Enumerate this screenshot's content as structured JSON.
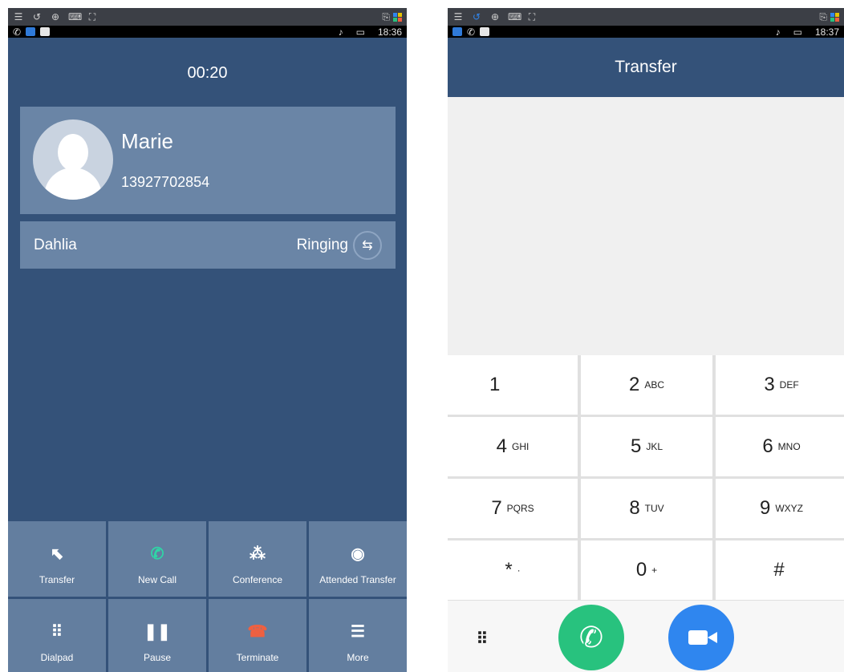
{
  "left_screen": {
    "topbar_icons": [
      "menu-icon",
      "back-icon",
      "search-icon",
      "keyboard-icon",
      "fullscreen-icon"
    ],
    "status_time": "18:36",
    "call_timer": "00:20",
    "contact": {
      "name": "Marie",
      "number": "13927702854"
    },
    "second_party": {
      "name": "Dahlia",
      "status": "Ringing"
    },
    "actions": [
      {
        "label": "Transfer",
        "icon": "transfer-icon",
        "glyph": "⬉"
      },
      {
        "label": "New Call",
        "icon": "phone-icon",
        "glyph": "✆"
      },
      {
        "label": "Conference",
        "icon": "conference-icon",
        "glyph": "⁂"
      },
      {
        "label": "Attended Transfer",
        "icon": "attended-transfer-icon",
        "glyph": "◉"
      },
      {
        "label": "Dialpad",
        "icon": "dialpad-icon",
        "glyph": "⠿"
      },
      {
        "label": "Pause",
        "icon": "pause-icon",
        "glyph": "❚❚"
      },
      {
        "label": "Terminate",
        "icon": "hangup-icon",
        "glyph": "☎"
      },
      {
        "label": "More",
        "icon": "more-icon",
        "glyph": "☰"
      }
    ]
  },
  "right_screen": {
    "status_time": "18:37",
    "title": "Transfer",
    "keys": [
      {
        "digit": "1",
        "letters": ""
      },
      {
        "digit": "2",
        "letters": "ABC"
      },
      {
        "digit": "3",
        "letters": "DEF"
      },
      {
        "digit": "4",
        "letters": "GHI"
      },
      {
        "digit": "5",
        "letters": "JKL"
      },
      {
        "digit": "6",
        "letters": "MNO"
      },
      {
        "digit": "7",
        "letters": "PQRS"
      },
      {
        "digit": "8",
        "letters": "TUV"
      },
      {
        "digit": "9",
        "letters": "WXYZ"
      },
      {
        "digit": "*",
        "letters": "·"
      },
      {
        "digit": "0",
        "letters": "+"
      },
      {
        "digit": "#",
        "letters": ""
      }
    ],
    "bottom": {
      "dialpad_icon": "dialpad-icon",
      "call_icon": "phone-icon",
      "video_icon": "video-camera-icon"
    }
  },
  "colors": {
    "header_blue": "#345279",
    "card_blue": "#6a85a6",
    "action_blue": "#637e9f",
    "call_green": "#28c27e",
    "video_blue": "#2f86ef",
    "terminate_red": "#ef6040",
    "new_call_teal": "#2fd6a6"
  }
}
